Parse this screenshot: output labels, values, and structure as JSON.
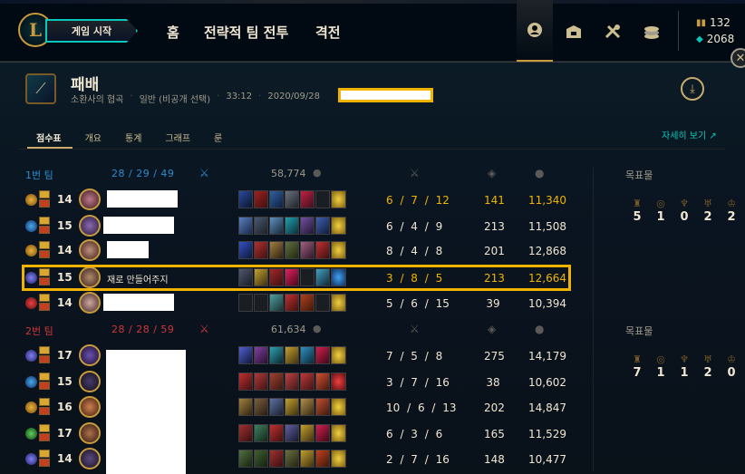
{
  "nav": {
    "logo": "L",
    "play_button": "게임 시작",
    "items": [
      "홈",
      "전략적 팀 전투",
      "격전"
    ],
    "icons": [
      "profile-icon",
      "collection-icon",
      "loot-icon",
      "store-icon"
    ],
    "rp": "132",
    "be": "2068"
  },
  "match": {
    "result": "패배",
    "map": "소환사의 협곡",
    "mode": "일반 (비공개 선택)",
    "duration": "33:12",
    "date": "2020/09/28",
    "more_details": "자세히 보기 ↗"
  },
  "tabs": [
    "점수표",
    "개요",
    "통계",
    "그래프",
    "룬"
  ],
  "teams": [
    {
      "name": "1번 팀",
      "kda": "28 / 29 / 49",
      "gold": "58,774",
      "objectives_label": "목표물",
      "objectives": [
        "5",
        "1",
        "0",
        "2",
        "2"
      ],
      "players": [
        {
          "level": "14",
          "name": "",
          "kda": "6 / 7 / 12",
          "cs": "141",
          "gold": "11,340"
        },
        {
          "level": "15",
          "name": "",
          "kda": "6 / 4 / 9",
          "cs": "213",
          "gold": "11,508"
        },
        {
          "level": "14",
          "name": "",
          "kda": "8 / 4 / 8",
          "cs": "201",
          "gold": "12,868"
        },
        {
          "level": "15",
          "name": "재로 만들어주지",
          "kda": "3 / 8 / 5",
          "cs": "213",
          "gold": "12,664"
        },
        {
          "level": "14",
          "name": "",
          "kda": "5 / 6 / 15",
          "cs": "39",
          "gold": "10,394"
        }
      ]
    },
    {
      "name": "2번 팀",
      "kda": "28 / 28 / 59",
      "gold": "61,634",
      "objectives_label": "목표물",
      "objectives": [
        "7",
        "1",
        "1",
        "2",
        "0"
      ],
      "players": [
        {
          "level": "17",
          "name": "",
          "kda": "7 / 5 / 8",
          "cs": "275",
          "gold": "14,179"
        },
        {
          "level": "15",
          "name": "",
          "kda": "3 / 7 / 16",
          "cs": "38",
          "gold": "10,602"
        },
        {
          "level": "16",
          "name": "",
          "kda": "10 / 6 / 13",
          "cs": "202",
          "gold": "14,847"
        },
        {
          "level": "17",
          "name": "",
          "kda": "6 / 3 / 6",
          "cs": "165",
          "gold": "11,529"
        },
        {
          "level": "14",
          "name": "",
          "kda": "2 / 7 / 16",
          "cs": "148",
          "gold": "10,477"
        }
      ]
    }
  ]
}
